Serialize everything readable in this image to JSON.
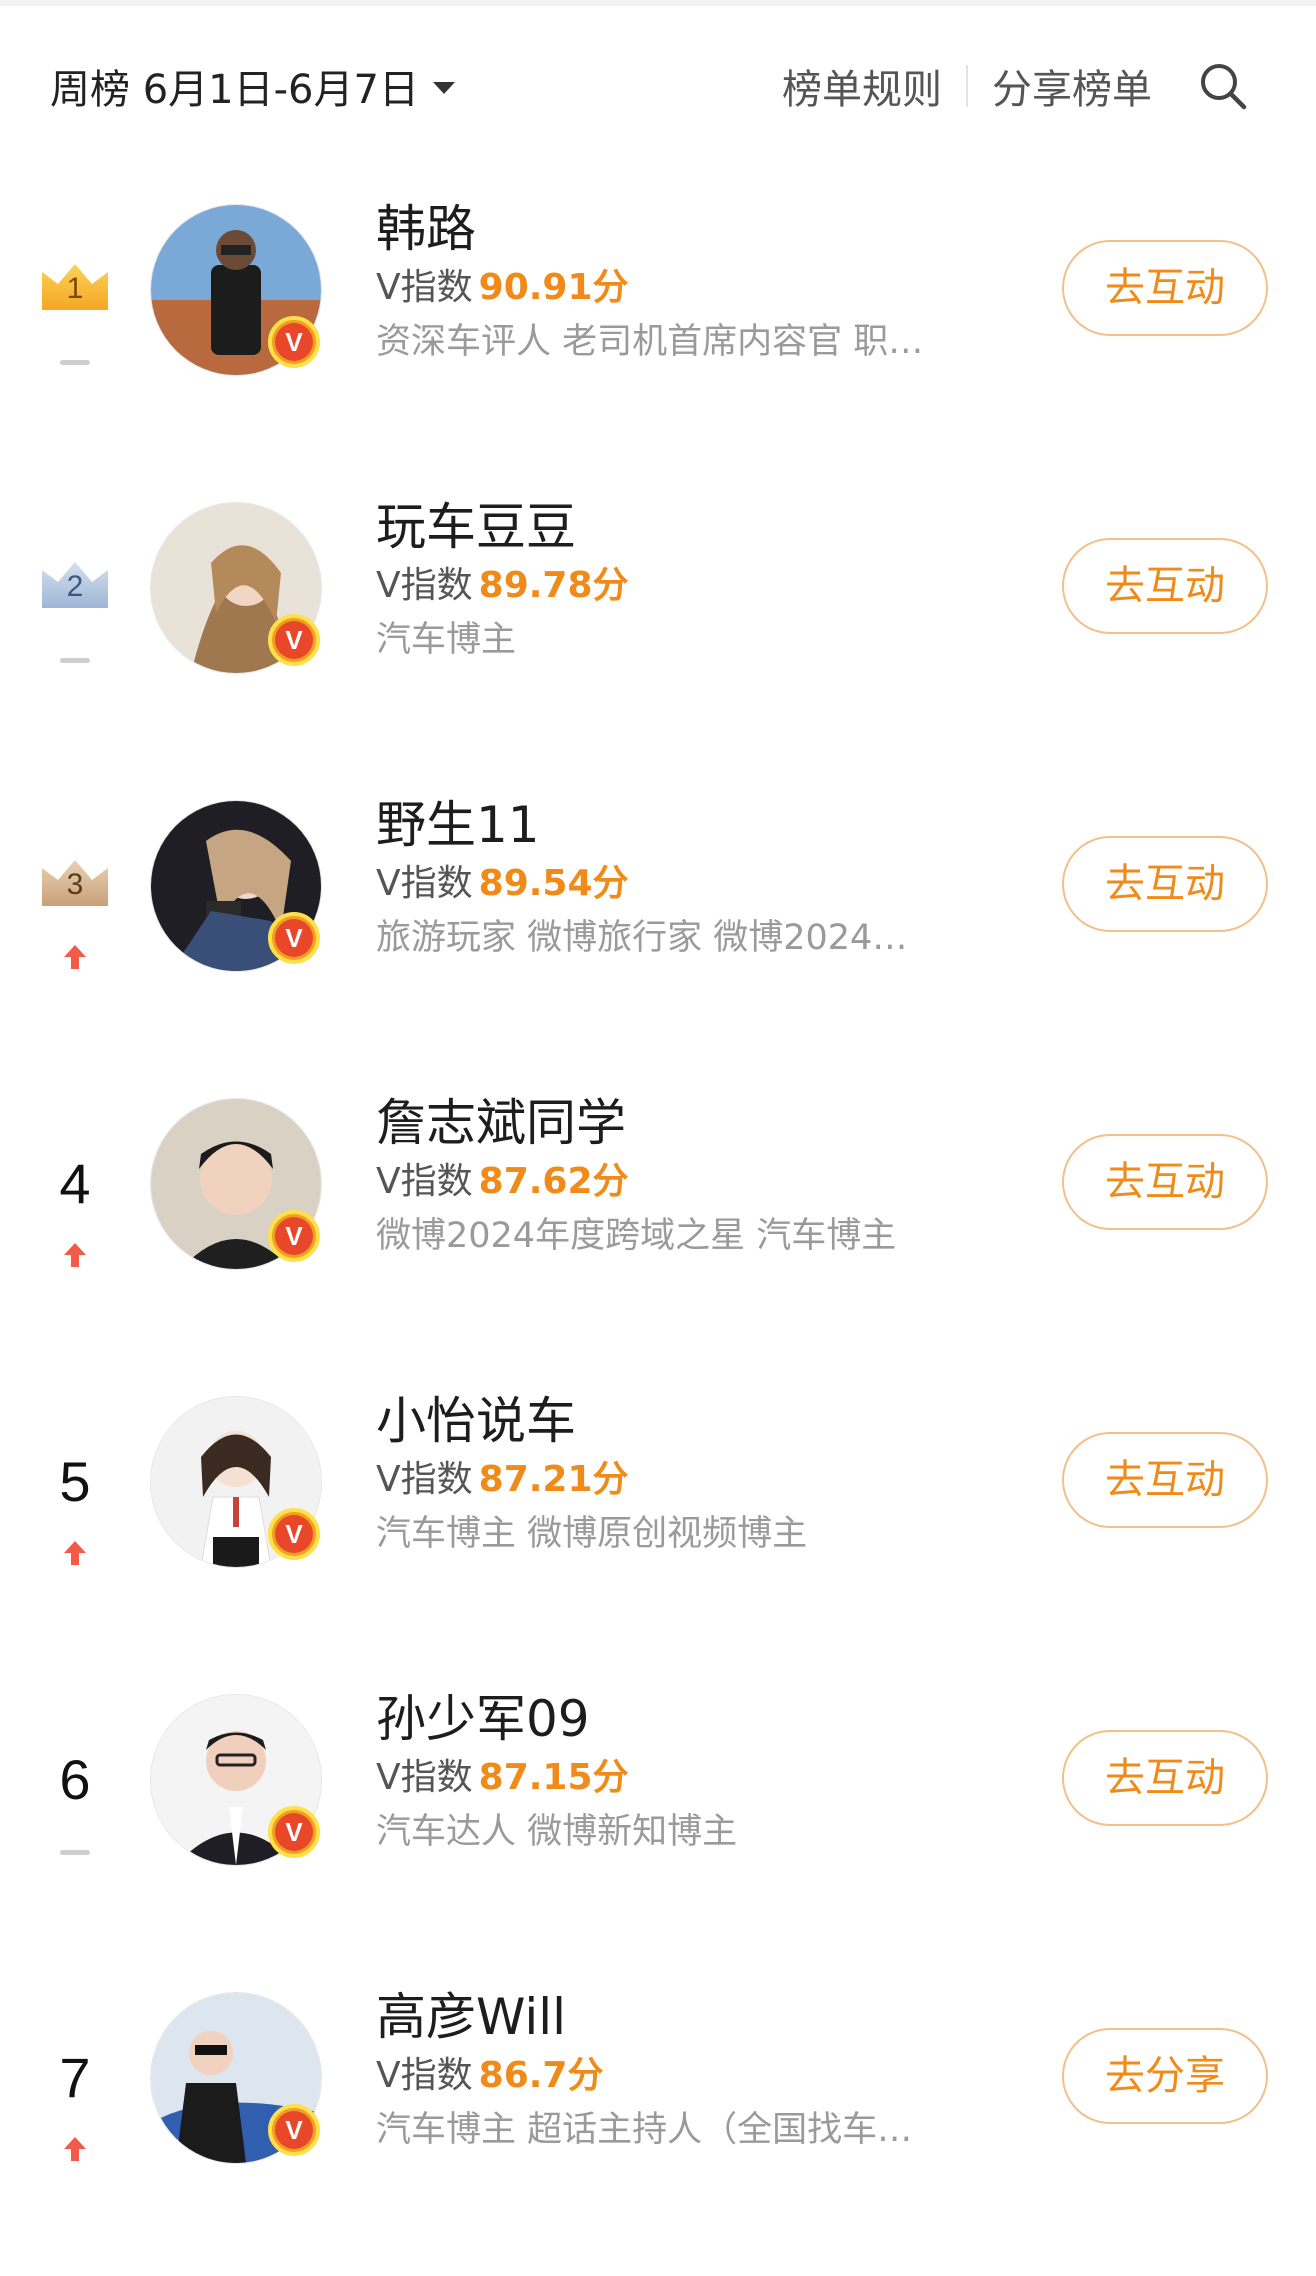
{
  "header": {
    "period_label": "周榜 6月1日-6月7日",
    "rules_label": "榜单规则",
    "share_label": "分享榜单",
    "search_icon": "search-icon"
  },
  "colors": {
    "accent_orange": "#f08a18",
    "trend_up_red": "#f25b4a",
    "v_badge": "#e8472a",
    "crown_gold": "#f5a623",
    "crown_silver": "#9fb6d6",
    "crown_bronze": "#c9a079"
  },
  "index_prefix": "V指数",
  "entries": [
    {
      "rank": "1",
      "crown": "gold",
      "trend": "flat",
      "name": "韩路",
      "score": "90.91分",
      "desc": "资深车评人 老司机首席内容官 职…",
      "action": "去互动"
    },
    {
      "rank": "2",
      "crown": "silver",
      "trend": "flat",
      "name": "玩车豆豆",
      "score": "89.78分",
      "desc": "汽车博主",
      "action": "去互动"
    },
    {
      "rank": "3",
      "crown": "bronze",
      "trend": "up",
      "name": "野生11",
      "score": "89.54分",
      "desc": "旅游玩家 微博旅行家 微博2024…",
      "action": "去互动"
    },
    {
      "rank": "4",
      "crown": "",
      "trend": "up",
      "name": "詹志斌同学",
      "score": "87.62分",
      "desc": "微博2024年度跨域之星 汽车博主",
      "action": "去互动"
    },
    {
      "rank": "5",
      "crown": "",
      "trend": "up",
      "name": "小怡说车",
      "score": "87.21分",
      "desc": "汽车博主 微博原创视频博主",
      "action": "去互动"
    },
    {
      "rank": "6",
      "crown": "",
      "trend": "flat",
      "name": "孙少军09",
      "score": "87.15分",
      "desc": "汽车达人 微博新知博主",
      "action": "去互动"
    },
    {
      "rank": "7",
      "crown": "",
      "trend": "up",
      "name": "高彦Will",
      "score": "86.7分",
      "desc": "汽车博主 超话主持人（全国找车…",
      "action": "去分享"
    }
  ]
}
